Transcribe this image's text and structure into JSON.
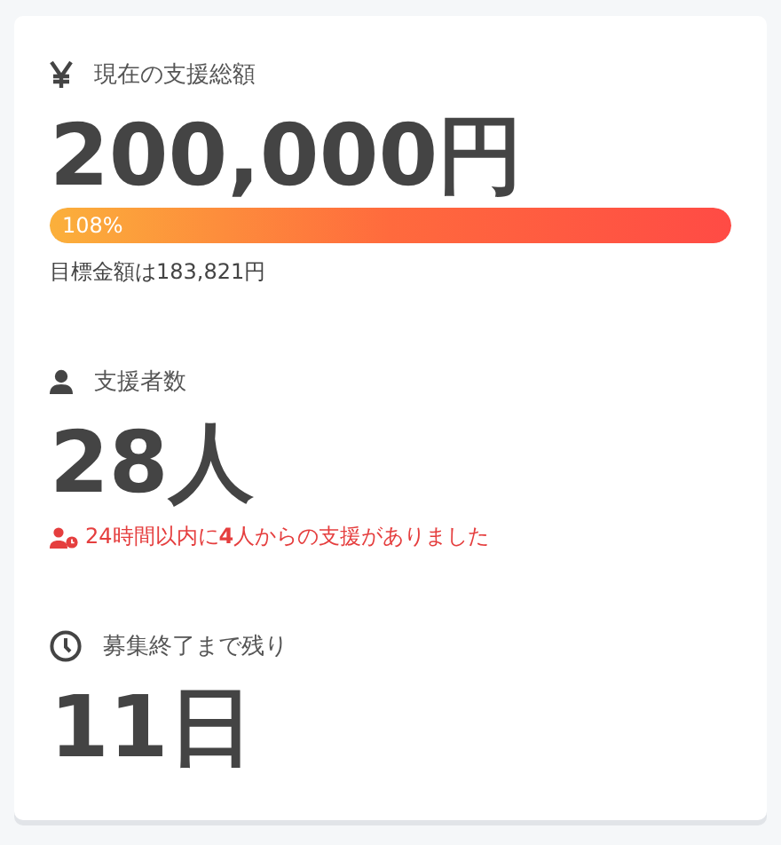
{
  "stats": [
    {
      "kind": "amount",
      "label": "現在の支援総額",
      "value": "200,000円",
      "progress": {
        "level": 1,
        "reading": "108%"
      },
      "note": "目標金額は183,821円"
    },
    {
      "kind": "supporters",
      "label": "支援者数",
      "value": "28人",
      "note": "24時間以内に**4**人からの支援がありました"
    },
    {
      "kind": "remaining",
      "label": "募集終了まで残り",
      "value": "11日"
    }
  ]
}
